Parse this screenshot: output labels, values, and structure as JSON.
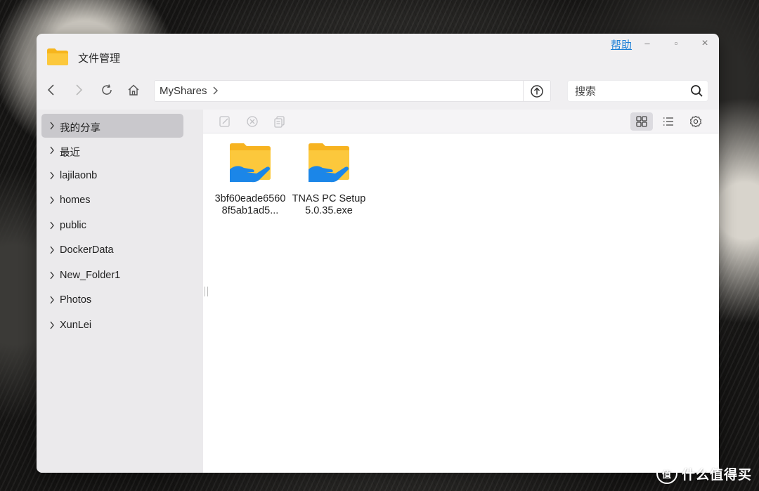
{
  "window": {
    "title": "文件管理",
    "help_label": "帮助",
    "controls": {
      "minimize": "–",
      "maximize": "▫",
      "close": "×"
    }
  },
  "nav": {
    "back_icon": "chevron-left-icon",
    "forward_icon": "chevron-right-icon",
    "refresh_icon": "refresh-icon",
    "home_icon": "home-icon"
  },
  "address": {
    "path": "MyShares",
    "separator": ">"
  },
  "search": {
    "placeholder": "搜索",
    "value": ""
  },
  "sidebar": {
    "items": [
      {
        "label": "我的分享",
        "active": true
      },
      {
        "label": "最近"
      },
      {
        "label": "lajilaonb"
      },
      {
        "label": "homes"
      },
      {
        "label": "public"
      },
      {
        "label": "DockerData"
      },
      {
        "label": "New_Folder1"
      },
      {
        "label": "Photos"
      },
      {
        "label": "XunLei"
      }
    ]
  },
  "toolbar": {
    "edit_icon": "edit-icon",
    "cancel_share_icon": "cancel-icon",
    "copy_icon": "copy-icon",
    "grid_view_icon": "grid-view-icon",
    "list_view_icon": "list-view-icon",
    "settings_icon": "gear-icon"
  },
  "files": [
    {
      "name": "3bf60eade65608f5ab1ad5...",
      "type": "shared-folder"
    },
    {
      "name": "TNAS PC Setup 5.0.35.exe",
      "type": "shared-folder"
    }
  ],
  "watermark": {
    "text": "什么值得买",
    "badge": "值"
  },
  "colors": {
    "accent": "#1b7fd6",
    "folder_yellow": "#fcc83c",
    "share_hand_blue": "#1b86e8",
    "sidebar_active": "#c9c8cc"
  }
}
